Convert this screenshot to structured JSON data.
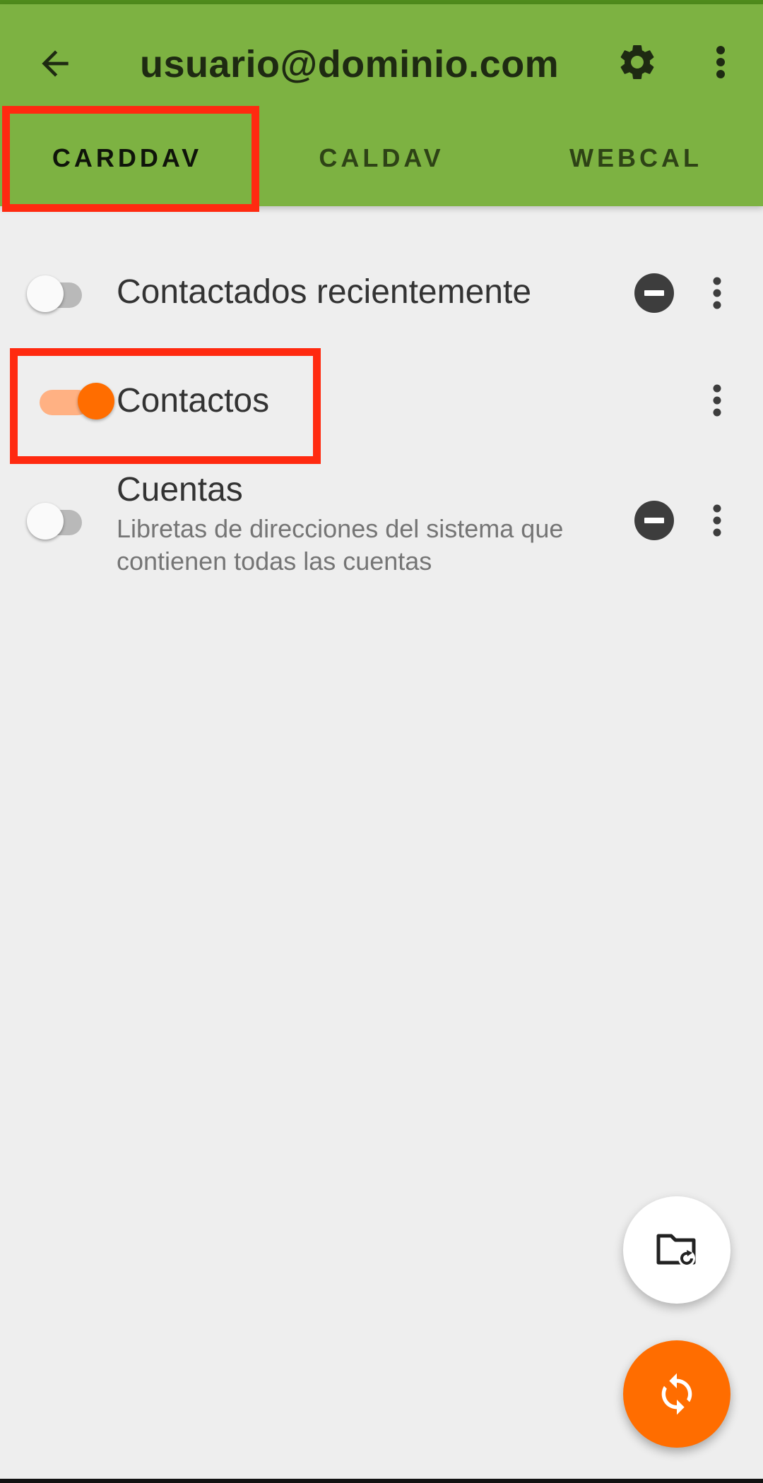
{
  "colors": {
    "app_bar": "#7db242",
    "accent": "#ff6d00",
    "highlight": "#ff2a10",
    "background": "#eeeeee"
  },
  "app_bar": {
    "title": "usuario@dominio.com",
    "back_icon": "arrow-back-icon",
    "settings_icon": "gear-icon",
    "overflow_icon": "more-vert-icon"
  },
  "tabs": [
    {
      "label": "CARDDAV",
      "selected": true
    },
    {
      "label": "CALDAV",
      "selected": false
    },
    {
      "label": "WEBCAL",
      "selected": false
    }
  ],
  "collections": [
    {
      "title": "Contactados recientemente",
      "description": "",
      "sync_enabled": false,
      "removable": true
    },
    {
      "title": "Contactos",
      "description": "",
      "sync_enabled": true,
      "removable": false
    },
    {
      "title": "Cuentas",
      "description": "Libretas de direcciones del sistema que contienen todas las cuentas",
      "sync_enabled": false,
      "removable": true
    }
  ],
  "fabs": {
    "refresh_icon": "folder-refresh-icon",
    "sync_icon": "sync-icon"
  }
}
